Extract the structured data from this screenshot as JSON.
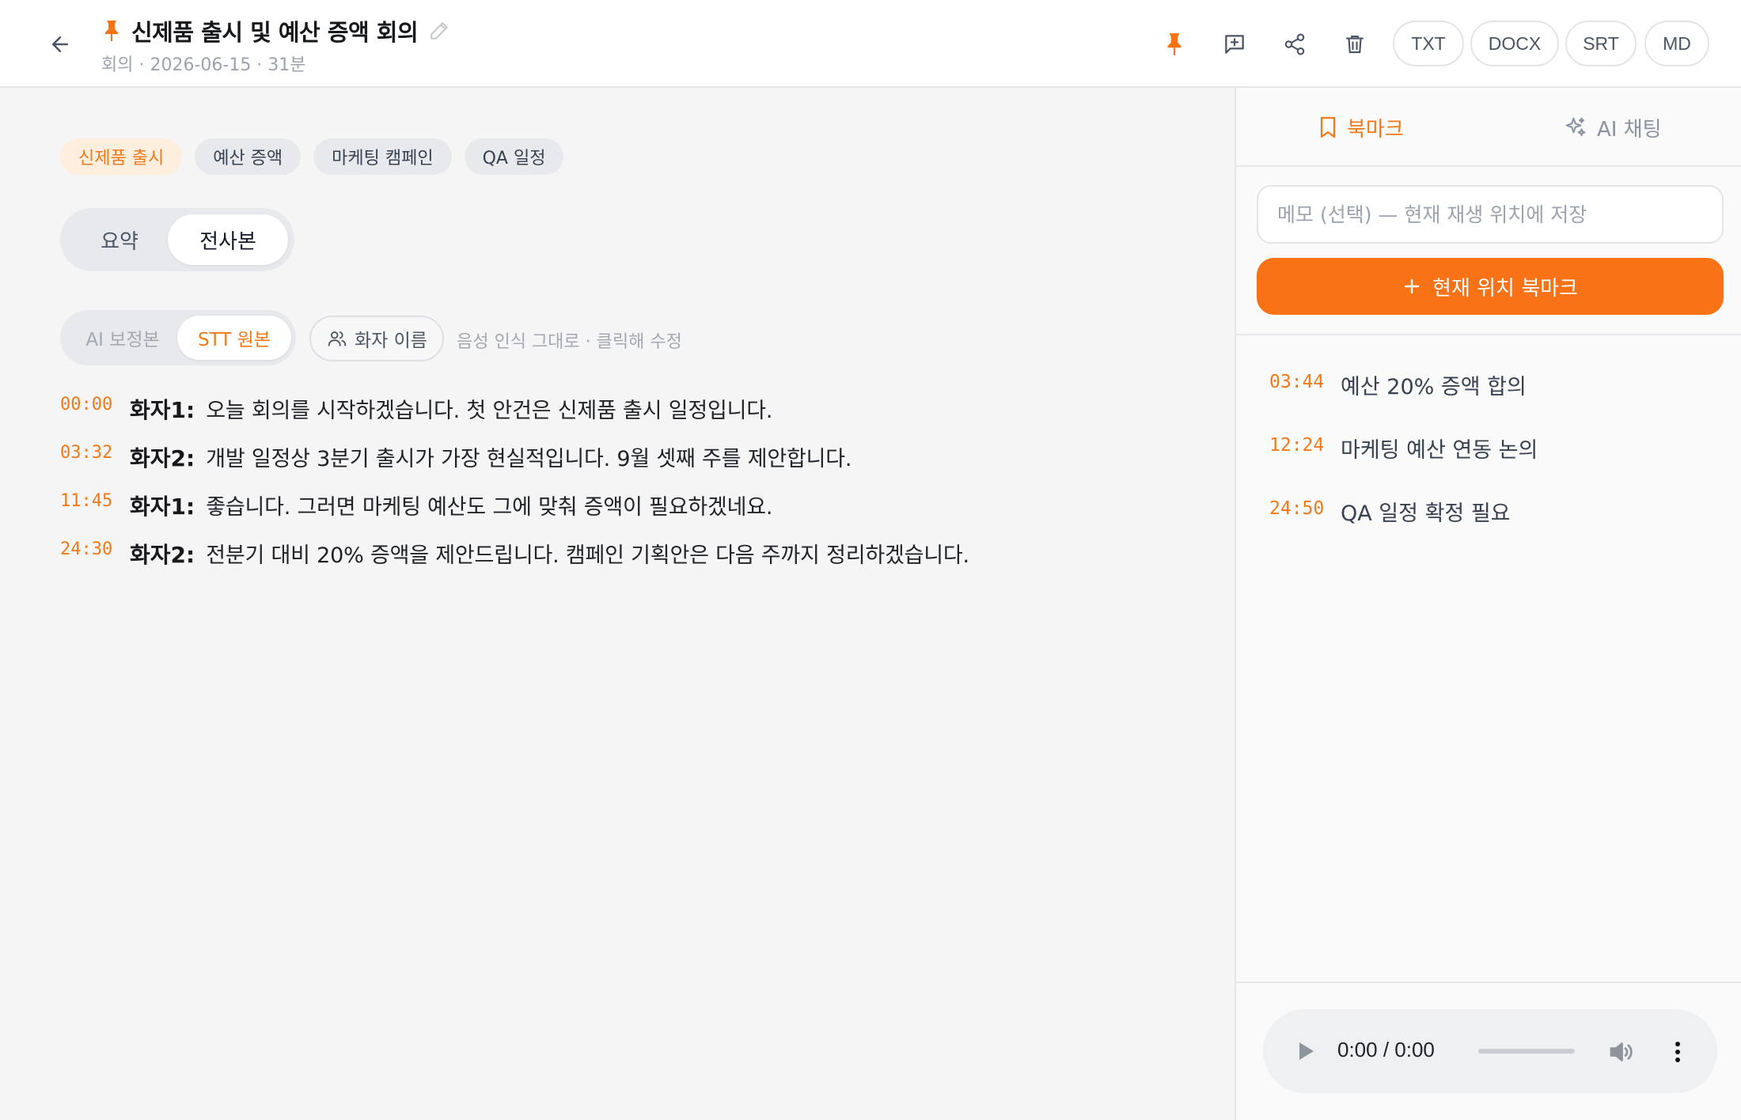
{
  "header": {
    "title": "신제품 출시 및 예산 증액 회의",
    "meta": "회의 · 2026-06-15 · 31분",
    "export_buttons": [
      "TXT",
      "DOCX",
      "SRT",
      "MD"
    ]
  },
  "tags": [
    "신제품 출시",
    "예산 증액",
    "마케팅 캠페인",
    "QA 일정"
  ],
  "view_toggle": {
    "summary": "요약",
    "transcript": "전사본"
  },
  "source_toggle": {
    "ai": "AI 보정본",
    "stt": "STT 원본"
  },
  "speaker_button": "화자 이름",
  "hint": "음성 인식 그대로 · 클릭해 수정",
  "transcript": [
    {
      "time": "00:00",
      "speaker": "화자1:",
      "text": "오늘 회의를 시작하겠습니다. 첫 안건은 신제품 출시 일정입니다."
    },
    {
      "time": "03:32",
      "speaker": "화자2:",
      "text": "개발 일정상 3분기 출시가 가장 현실적입니다. 9월 셋째 주를 제안합니다."
    },
    {
      "time": "11:45",
      "speaker": "화자1:",
      "text": "좋습니다. 그러면 마케팅 예산도 그에 맞춰 증액이 필요하겠네요."
    },
    {
      "time": "24:30",
      "speaker": "화자2:",
      "text": "전분기 대비 20% 증액을 제안드립니다. 캠페인 기획안은 다음 주까지 정리하겠습니다."
    }
  ],
  "sidebar": {
    "tab_bookmark": "북마크",
    "tab_ai_chat": "AI 채팅",
    "memo_placeholder": "메모 (선택) — 현재 재생 위치에 저장",
    "add_bookmark": "현재 위치 북마크",
    "bookmarks": [
      {
        "time": "03:44",
        "note": "예산 20% 증액 합의"
      },
      {
        "time": "12:24",
        "note": "마케팅 예산 연동 논의"
      },
      {
        "time": "24:50",
        "note": "QA 일정 확정 필요"
      }
    ]
  },
  "player": {
    "time": "0:00 / 0:00"
  },
  "colors": {
    "accent": "#f97316",
    "accent_text": "#f07a1a"
  }
}
